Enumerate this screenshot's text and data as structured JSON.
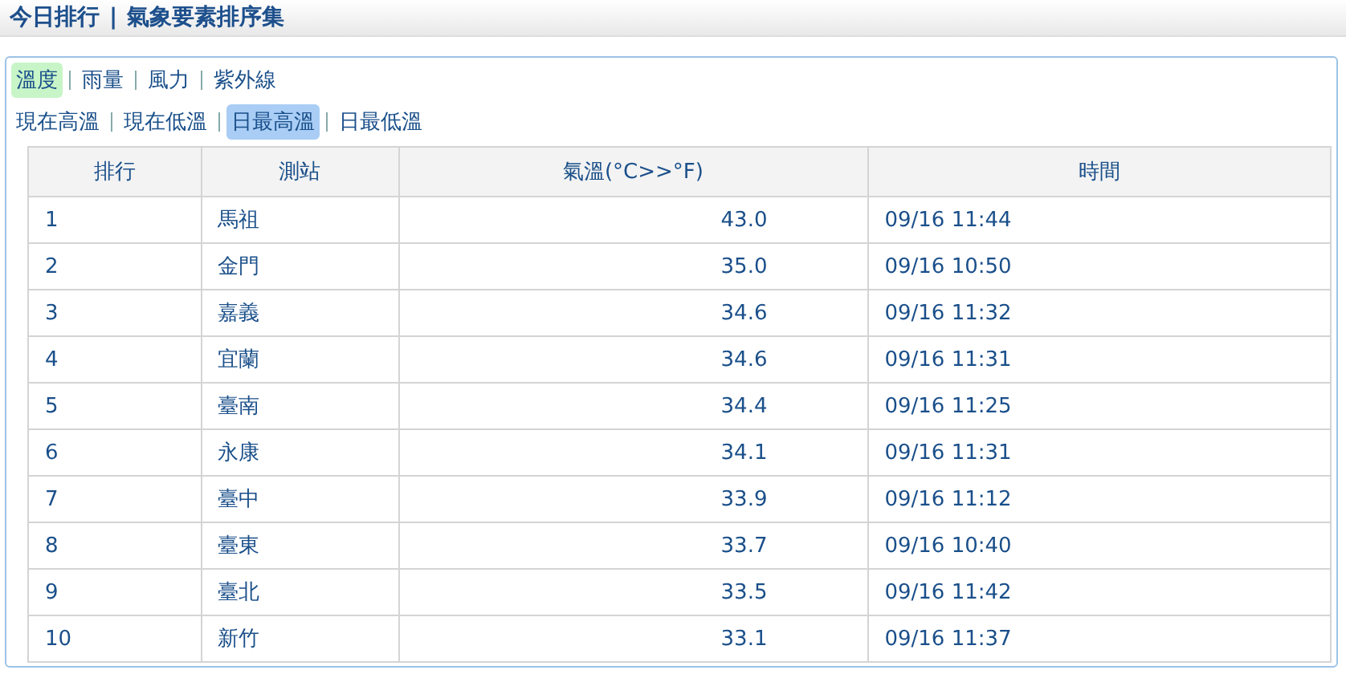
{
  "header": {
    "title": "今日排行",
    "separator": "|",
    "subtitle": "氣象要素排序集"
  },
  "tabs": [
    {
      "label": "溫度",
      "selected": true
    },
    {
      "label": "雨量",
      "selected": false
    },
    {
      "label": "風力",
      "selected": false
    },
    {
      "label": "紫外線",
      "selected": false
    }
  ],
  "subtabs": [
    {
      "label": "現在高溫",
      "selected": false
    },
    {
      "label": "現在低溫",
      "selected": false
    },
    {
      "label": "日最高溫",
      "selected": true
    },
    {
      "label": "日最低溫",
      "selected": false
    }
  ],
  "table": {
    "columns": [
      "排行",
      "測站",
      "氣溫(°C>>°F)",
      "時間"
    ],
    "rows": [
      [
        "1",
        "馬祖",
        "43.0",
        "09/16 11:44"
      ],
      [
        "2",
        "金門",
        "35.0",
        "09/16 10:50"
      ],
      [
        "3",
        "嘉義",
        "34.6",
        "09/16 11:32"
      ],
      [
        "4",
        "宜蘭",
        "34.6",
        "09/16 11:31"
      ],
      [
        "5",
        "臺南",
        "34.4",
        "09/16 11:25"
      ],
      [
        "6",
        "永康",
        "34.1",
        "09/16 11:31"
      ],
      [
        "7",
        "臺中",
        "33.9",
        "09/16 11:12"
      ],
      [
        "8",
        "臺東",
        "33.7",
        "09/16 10:40"
      ],
      [
        "9",
        "臺北",
        "33.5",
        "09/16 11:42"
      ],
      [
        "10",
        "新竹",
        "33.1",
        "09/16 11:37"
      ]
    ]
  }
}
